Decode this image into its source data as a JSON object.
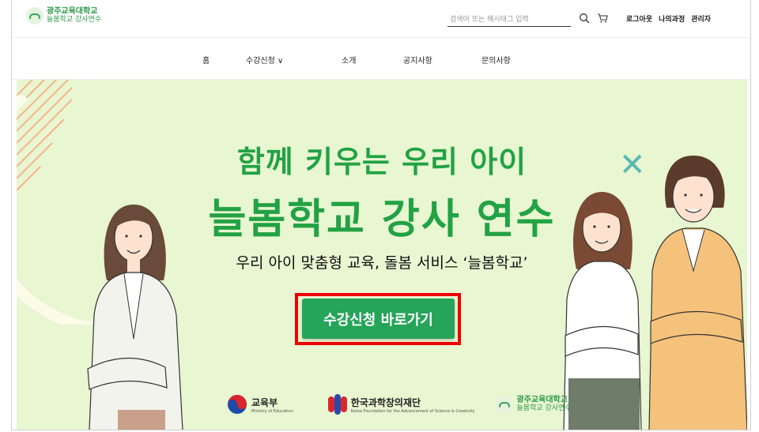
{
  "header": {
    "logo_main": "광주교육대학교",
    "logo_sub": "늘봄학교 강사연수",
    "search_placeholder": "검색어 또는 해시태그 입력",
    "links": [
      "로그아웃",
      "나의과정",
      "관리자"
    ]
  },
  "nav": {
    "items": [
      "홈",
      "수강신청 ∨",
      "소개",
      "공지사항",
      "문의사항"
    ]
  },
  "hero": {
    "headline1": "함께 키우는 우리 아이",
    "headline2": "늘봄학교 강사 연수",
    "subline": "우리 아이 맞춤형 교육, 돌봄 서비스 ‘늘봄학교’",
    "cta_label": "수강신청 바로가기",
    "accent_color": "#22a244",
    "background_color": "#e8f6d1"
  },
  "partners": {
    "moe_name": "교육부",
    "moe_sub": "Ministry of Education",
    "kofac_name": "한국과학창의재단",
    "kofac_sub": "Korea Foundation for the Advancement of Science & Creativity",
    "univ_main": "광주교육대학교",
    "univ_sub": "늘봄학교 강사연수"
  }
}
